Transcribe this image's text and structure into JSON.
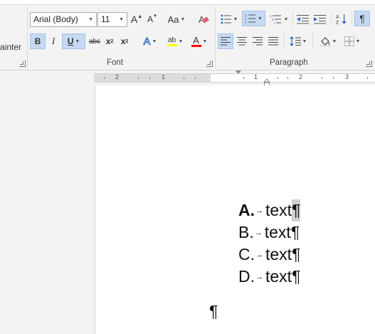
{
  "clipboard": {
    "label": "ainter"
  },
  "font": {
    "name": "Arial (Body)",
    "size": "11",
    "grow_label": "A",
    "shrink_label": "A",
    "case_label": "Aa",
    "group_label": "Font",
    "bold": "B",
    "italic": "I",
    "underline": "U",
    "strike": "abc",
    "subscript_base": "x",
    "subscript_sub": "2",
    "superscript_base": "x",
    "superscript_sup": "2",
    "effects": "A",
    "highlight": "ab",
    "color": "A",
    "highlight_color": "#ffff00",
    "font_color": "#ff0000"
  },
  "paragraph": {
    "group_label": "Paragraph",
    "pilcrow": "¶"
  },
  "ruler": {
    "numbers": [
      "2",
      "1",
      "1",
      "2",
      "3"
    ]
  },
  "document": {
    "list": [
      {
        "marker": "A.",
        "text": "text",
        "pilcrow": "¶"
      },
      {
        "marker": "B.",
        "text": "text",
        "pilcrow": "¶"
      },
      {
        "marker": "C.",
        "text": "text",
        "pilcrow": "¶"
      },
      {
        "marker": "D.",
        "text": "text",
        "pilcrow": "¶"
      }
    ],
    "tab_arrow": "→",
    "empty_pilcrow": "¶"
  }
}
